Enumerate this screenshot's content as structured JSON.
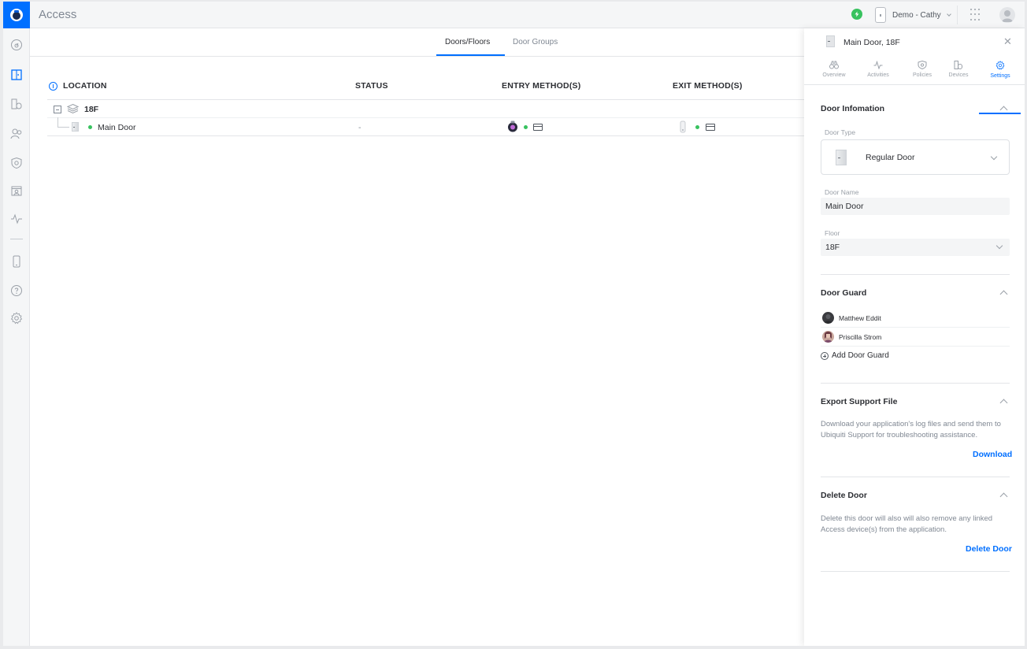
{
  "app": {
    "title": "Access"
  },
  "topbar": {
    "console_name": "Demo - Cathy"
  },
  "main": {
    "tabs": [
      {
        "label": "Doors/Floors",
        "active": true
      },
      {
        "label": "Door Groups",
        "active": false
      }
    ],
    "table": {
      "columns": [
        "LOCATION",
        "STATUS",
        "ENTRY METHOD(S)",
        "EXIT METHOD(S)"
      ],
      "floor": {
        "name": "18F"
      },
      "rows": [
        {
          "name": "Main Door",
          "status": "-"
        }
      ]
    }
  },
  "panel": {
    "title": "Main Door, 18F",
    "tabs": [
      {
        "label": "Overview",
        "icon": "binoculars-icon"
      },
      {
        "label": "Activities",
        "icon": "activity-icon"
      },
      {
        "label": "Policies",
        "icon": "shield-icon"
      },
      {
        "label": "Devices",
        "icon": "devices-icon"
      },
      {
        "label": "Settings",
        "icon": "gear-icon",
        "active": true
      }
    ],
    "door_info": {
      "title": "Door Infomation",
      "door_type_label": "Door Type",
      "door_type_value": "Regular Door",
      "door_name_label": "Door Name",
      "door_name_value": "Main Door",
      "floor_label": "Floor",
      "floor_value": "18F"
    },
    "door_guard": {
      "title": "Door Guard",
      "guards": [
        "Matthew Eddit",
        "Priscilla Strom"
      ],
      "add_label": "Add Door Guard"
    },
    "export": {
      "title": "Export Support File",
      "description": "Download your application's log files and send them to Ubiquiti Support for troubleshooting assistance.",
      "action": "Download"
    },
    "delete": {
      "title": "Delete Door",
      "description": "Delete this door will also will also remove any linked Access device(s) from the application.",
      "action": "Delete Door"
    }
  },
  "colors": {
    "accent": "#006fff",
    "online": "#38c25f"
  }
}
